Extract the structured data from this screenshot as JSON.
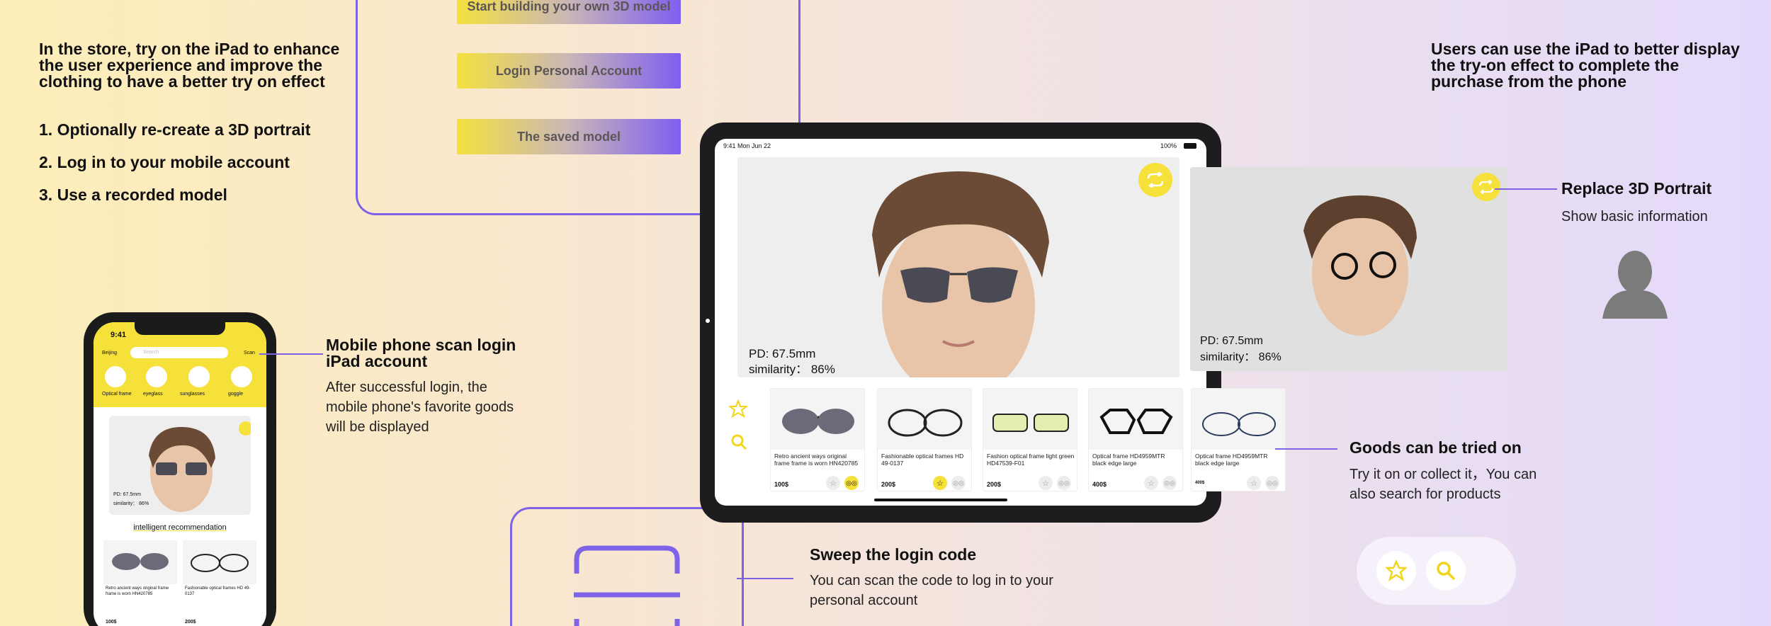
{
  "intro": {
    "title": "In the store, try on the iPad to enhance the user experience and improve the clothing to have a better try on effect",
    "steps": [
      "1. Optionally re-create a 3D portrait",
      "2. Log in to your mobile account",
      "3. Use a recorded model"
    ]
  },
  "buttons": {
    "build": "Start building your own 3D model",
    "login": "Login Personal Account",
    "saved": "The saved model"
  },
  "right_intro": "Users can use the iPad to better display the try-on effect to complete the purchase from the phone",
  "ipad": {
    "time": "9:41 Mon Jun 22",
    "battery": "100%",
    "pd": "PD: 67.5mm",
    "similarity": "similarity： 86%",
    "products": [
      {
        "name": "Retro ancient ways original frame frame is worn HN420785",
        "price": "100$"
      },
      {
        "name": "Fashionable optical frames HD 49-0137",
        "price": "200$"
      },
      {
        "name": "Fashion optical frame light green HD47539-F01",
        "price": "200$"
      },
      {
        "name": "Optical frame HD4959MTR black edge large",
        "price": "400$"
      },
      {
        "name": "Optical frame HD4959MTR black edge large",
        "price": "400$"
      }
    ]
  },
  "side_portrait": {
    "pd": "PD: 67.5mm",
    "similarity": "similarity： 86%"
  },
  "labels": {
    "replace_title": "Replace 3D Portrait",
    "replace_sub": "Show basic information",
    "goods_title": "Goods can be tried on",
    "goods_sub": "Try it on or collect it，You can also search for products",
    "scan_title": "Mobile phone scan login iPad account",
    "scan_sub": "After successful login, the mobile phone's favorite goods will be displayed",
    "sweep_title": "Sweep the login code",
    "sweep_sub": "You can scan the code to log in to your personal account"
  },
  "phone": {
    "time": "9:41",
    "location": "Beijing",
    "search_placeholder": "Search",
    "scan": "Scan",
    "categories": [
      "Optical frame",
      "eyeglass",
      "sunglasses",
      "goggle"
    ],
    "pd": "PD: 67.5mm",
    "similarity": "similarity： 86%",
    "recommendation": "intelligent recommendation",
    "products": [
      {
        "name": "Retro ancient ways original frame frame is worn HN420785",
        "price": "100$"
      },
      {
        "name": "Fashionable optical frames HD 49-0137",
        "price": "200$"
      }
    ]
  },
  "colors": {
    "accent": "#7f63e6",
    "yellow": "#f6e03a"
  }
}
